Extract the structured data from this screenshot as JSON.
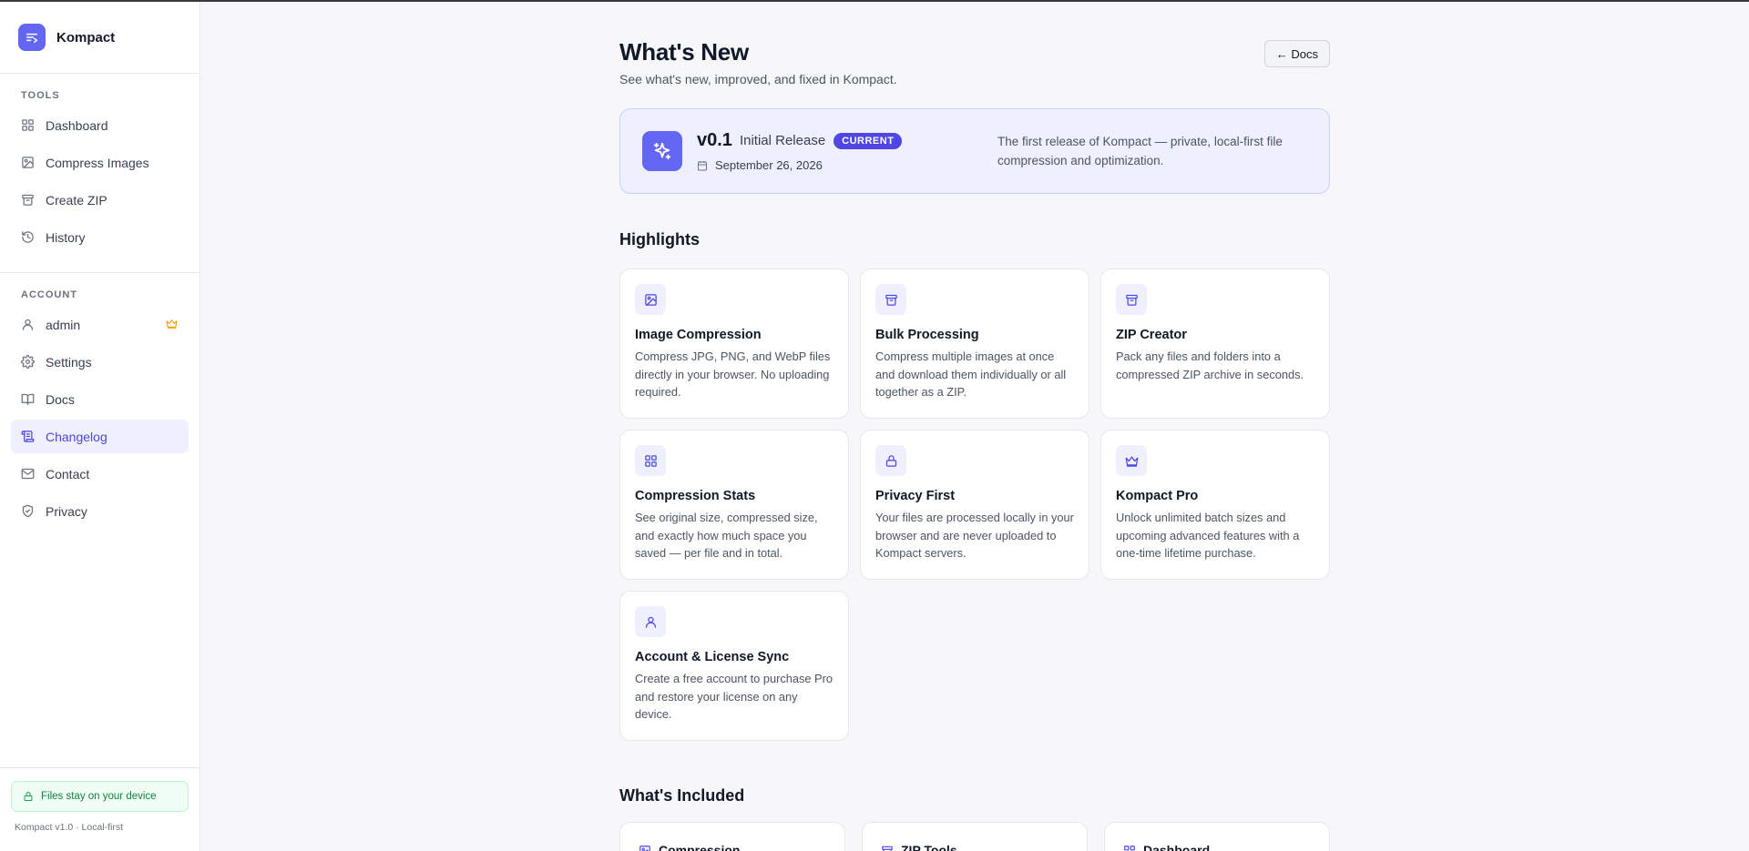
{
  "app": {
    "name": "Kompact"
  },
  "sidebar": {
    "tools_label": "TOOLS",
    "account_label": "ACCOUNT",
    "tools": [
      {
        "label": "Dashboard",
        "icon": "dashboard-icon"
      },
      {
        "label": "Compress Images",
        "icon": "image-icon"
      },
      {
        "label": "Create ZIP",
        "icon": "archive-icon"
      },
      {
        "label": "History",
        "icon": "history-icon"
      }
    ],
    "account": [
      {
        "label": "admin",
        "icon": "user-icon",
        "badge_icon": "crown-icon"
      },
      {
        "label": "Settings",
        "icon": "gear-icon"
      },
      {
        "label": "Docs",
        "icon": "book-icon"
      },
      {
        "label": "Changelog",
        "icon": "scroll-icon",
        "active": true
      },
      {
        "label": "Contact",
        "icon": "mail-icon"
      },
      {
        "label": "Privacy",
        "icon": "shield-icon"
      }
    ],
    "device_badge": "Files stay on your device",
    "version": "Kompact v1.0 · Local-first"
  },
  "header": {
    "title": "What's New",
    "subtitle": "See what's new, improved, and fixed in Kompact.",
    "docs_button": "← Docs"
  },
  "release": {
    "version": "v0.1",
    "name": "Initial Release",
    "badge": "CURRENT",
    "date": "September 26, 2026",
    "description": "The first release of Kompact — private, local-first file compression and optimization."
  },
  "highlights": {
    "title": "Highlights",
    "items": [
      {
        "title": "Image Compression",
        "desc": "Compress JPG, PNG, and WebP files directly in your browser. No uploading required.",
        "icon": "image-icon"
      },
      {
        "title": "Bulk Processing",
        "desc": "Compress multiple images at once and download them individually or all together as a ZIP.",
        "icon": "archive-icon"
      },
      {
        "title": "ZIP Creator",
        "desc": "Pack any files and folders into a compressed ZIP archive in seconds.",
        "icon": "archive-icon"
      },
      {
        "title": "Compression Stats",
        "desc": "See original size, compressed size, and exactly how much space you saved — per file and in total.",
        "icon": "dashboard-icon"
      },
      {
        "title": "Privacy First",
        "desc": "Your files are processed locally in your browser and are never uploaded to Kompact servers.",
        "icon": "lock-icon"
      },
      {
        "title": "Kompact Pro",
        "desc": "Unlock unlimited batch sizes and upcoming advanced features with a one-time lifetime purchase.",
        "icon": "crown-icon"
      },
      {
        "title": "Account & License Sync",
        "desc": "Create a free account to purchase Pro and restore your license on any device.",
        "icon": "user-icon"
      }
    ]
  },
  "included": {
    "title": "What's Included",
    "items": [
      {
        "label": "Compression",
        "icon": "image-icon"
      },
      {
        "label": "ZIP Tools",
        "icon": "archive-icon"
      },
      {
        "label": "Dashboard",
        "icon": "dashboard-icon"
      }
    ]
  },
  "colors": {
    "accent": "#6366f1",
    "accent_dark": "#4f46e5",
    "success": "#15803d"
  }
}
